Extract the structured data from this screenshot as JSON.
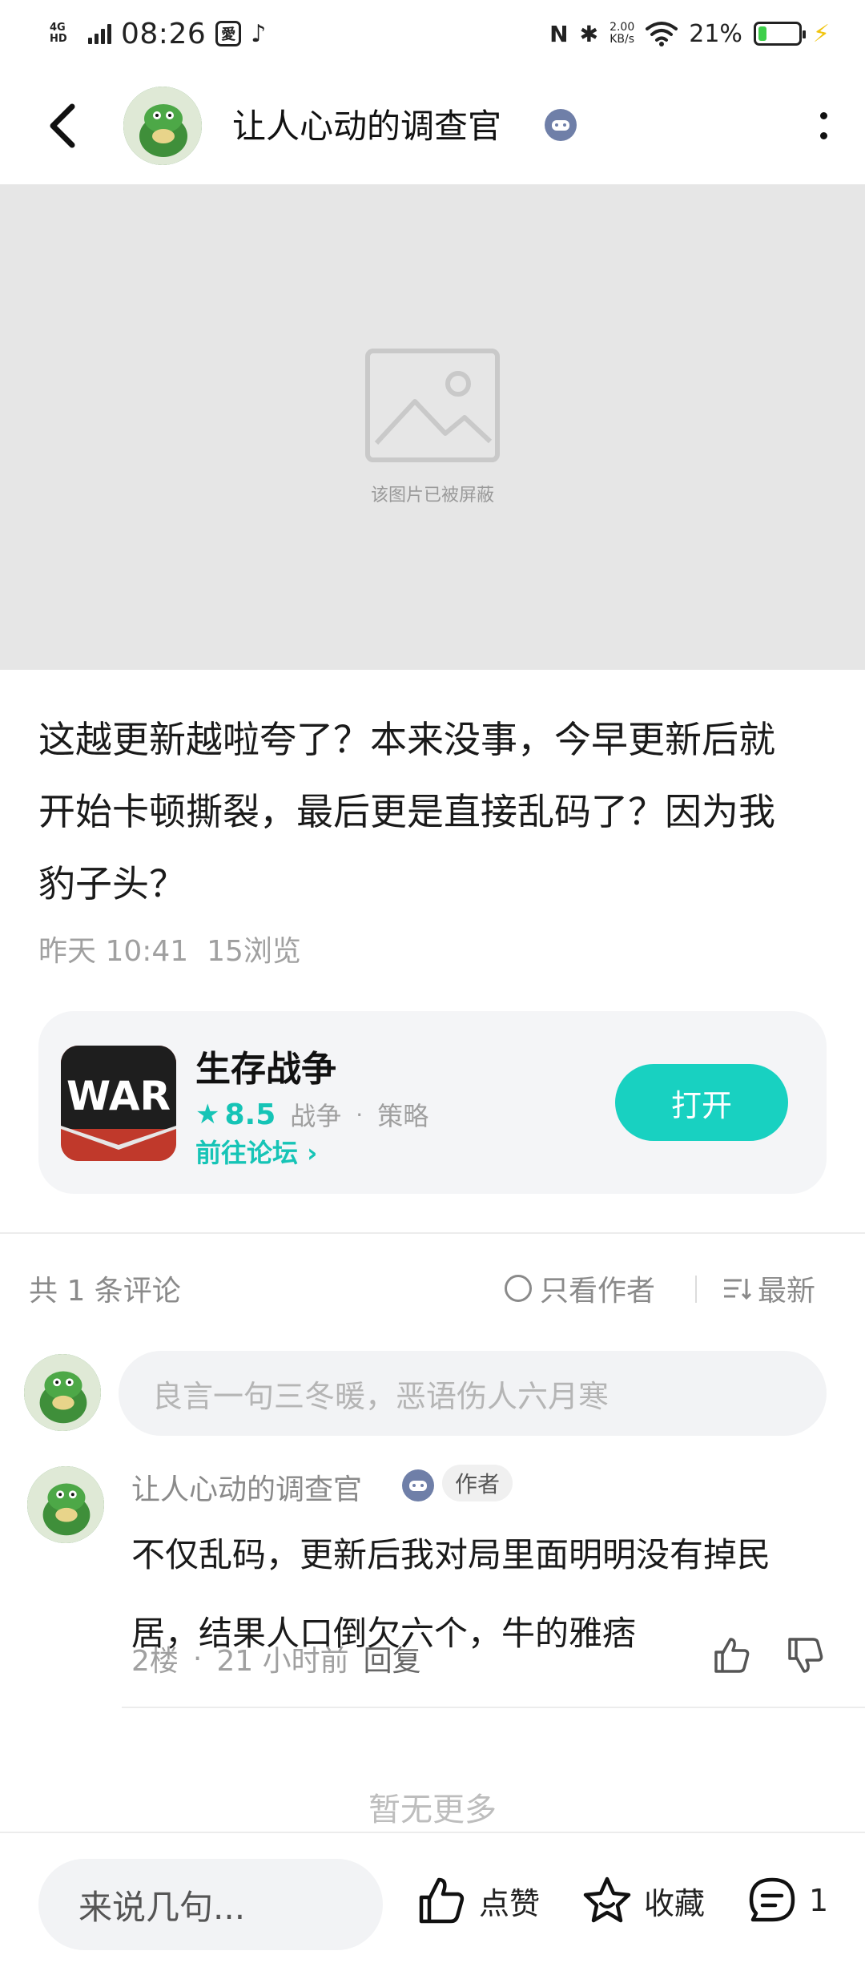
{
  "status_bar": {
    "network": "4G HD",
    "time": "08:26",
    "app_badge": "愛",
    "speed_value": "2.00",
    "speed_unit": "KB/s",
    "battery_percent": "21%",
    "battery_level": 0.21
  },
  "header": {
    "title": "让人心动的调查官"
  },
  "post": {
    "blocked_image_text": "该图片已被屏蔽",
    "content": "这越更新越啦夸了？本来没事，今早更新后就开始卡顿撕裂，最后更是直接乱码了？因为我豹子头？",
    "time": "昨天 10:41",
    "views": "15浏览"
  },
  "app_card": {
    "name": "生存战争",
    "rating": "8.5",
    "tag1": "战争",
    "separator": "·",
    "tag2": "策略",
    "forum_link": "前往论坛",
    "open_label": "打开",
    "icon_text": "WAR"
  },
  "comments_header": {
    "count_label": "共 1 条评论",
    "only_author_label": "只看作者",
    "sort_label": "最新"
  },
  "comment_input": {
    "placeholder": "良言一句三冬暖，恶语伤人六月寒"
  },
  "comments": [
    {
      "name": "让人心动的调查官",
      "author_tag": "作者",
      "text": "不仅乱码，更新后我对局里面明明没有掉民居，结果人口倒欠六个，牛的雅痞",
      "floor": "2楼",
      "dot": "·",
      "time": "21 小时前",
      "reply": "回复"
    }
  ],
  "no_more": "暂无更多",
  "bottom_bar": {
    "input_placeholder": "来说几句...",
    "like_label": "点赞",
    "fav_label": "收藏",
    "comment_count": "1"
  },
  "colors": {
    "accent": "#18d1c1",
    "blocked_bg": "#e6e6e6",
    "app_icon_bg": "#b23227"
  }
}
